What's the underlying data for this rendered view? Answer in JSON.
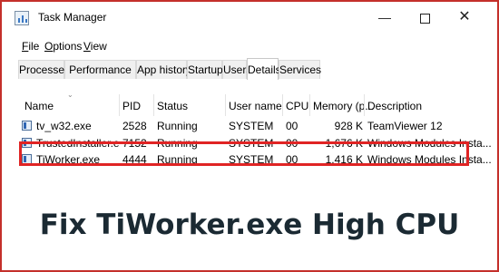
{
  "window": {
    "title": "Task Manager"
  },
  "controls": {
    "minimize": "—",
    "close": "✕"
  },
  "menu": [
    {
      "label": "File",
      "mnemonic": "F",
      "rest": "ile"
    },
    {
      "label": "Options",
      "mnemonic": "O",
      "rest": "ptions"
    },
    {
      "label": "View",
      "mnemonic": "V",
      "rest": "iew"
    }
  ],
  "tabs": [
    {
      "label": "Processes",
      "active": false
    },
    {
      "label": "Performance",
      "active": false
    },
    {
      "label": "App history",
      "active": false
    },
    {
      "label": "Startup",
      "active": false
    },
    {
      "label": "Users",
      "active": false
    },
    {
      "label": "Details",
      "active": true
    },
    {
      "label": "Services",
      "active": false
    }
  ],
  "columns": [
    "Name",
    "PID",
    "Status",
    "User name",
    "CPU",
    "Memory (p...",
    "Description"
  ],
  "rows": [
    {
      "name": "tv_w32.exe",
      "pid": "2528",
      "status": "Running",
      "user": "SYSTEM",
      "cpu": "00",
      "memory": "928 K",
      "description": "TeamViewer 12",
      "highlighted": false
    },
    {
      "name": "TrustedInstaller.exe",
      "pid": "7152",
      "status": "Running",
      "user": "SYSTEM",
      "cpu": "00",
      "memory": "1,676 K",
      "description": "Windows Modules Insta...",
      "highlighted": false
    },
    {
      "name": "TiWorker.exe",
      "pid": "4444",
      "status": "Running",
      "user": "SYSTEM",
      "cpu": "00",
      "memory": "1,416 K",
      "description": "Windows Modules Insta...",
      "highlighted": true
    }
  ],
  "caption": "Fix TiWorker.exe High CPU Usage",
  "colors": {
    "frame": "#c4302b",
    "highlight": "#e02424",
    "caption_text": "#1b2a33",
    "icon_blue": "#2f66b3"
  }
}
